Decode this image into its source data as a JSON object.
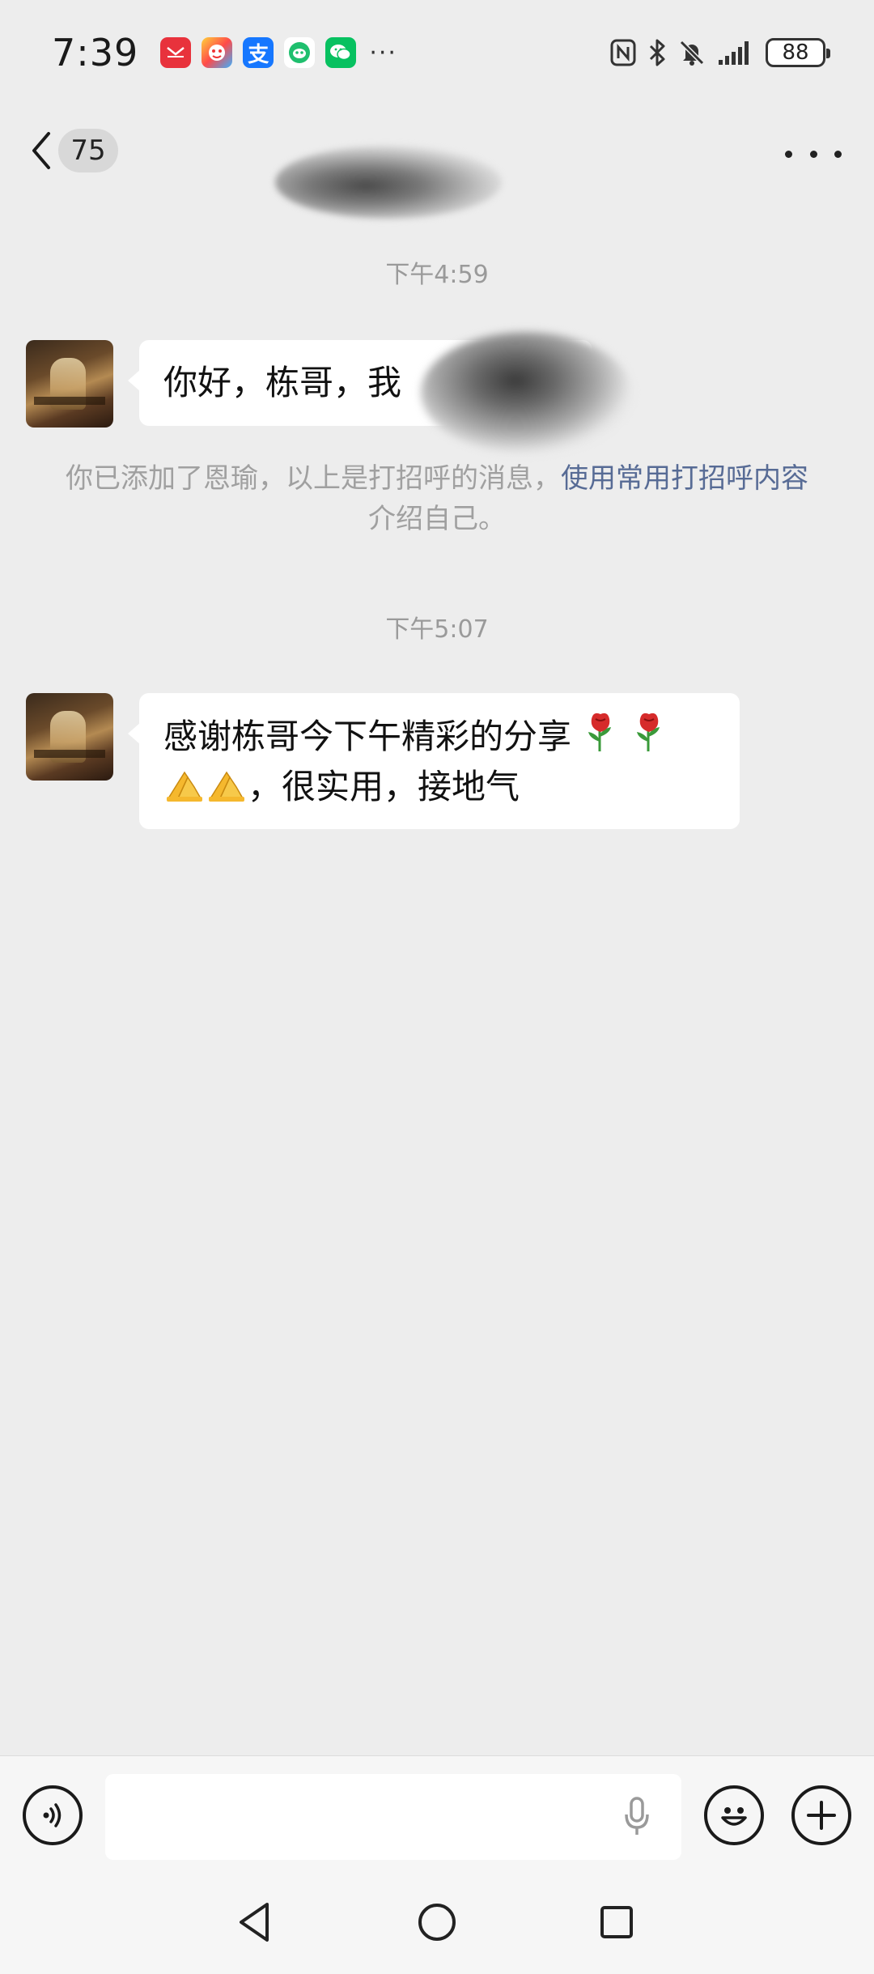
{
  "status_bar": {
    "time": "7:39",
    "notification_icons": [
      "huawei-app-icon",
      "game-app-icon",
      "alipay-icon",
      "green-app-icon",
      "wechat-icon"
    ],
    "more_label": "···",
    "battery_level": "88"
  },
  "header": {
    "unread_count": "75"
  },
  "chat": {
    "messages": [
      {
        "timestamp": "下午4:59",
        "text": "你好，栋哥，我"
      },
      {
        "timestamp": "下午5:07",
        "text_line1": "感谢栋哥今下午精彩的分享",
        "text_line2_suffix": "，很实用，接地气"
      }
    ],
    "system_notice": {
      "prefix": "你已添加了恩瑜，以上是打招呼的消息，",
      "link": "使用常用打招呼内容",
      "suffix": "介绍自己。"
    }
  },
  "colors": {
    "background": "#ededed",
    "bubble": "#ffffff",
    "link": "#576b95",
    "timestamp": "#9a9a9a"
  }
}
